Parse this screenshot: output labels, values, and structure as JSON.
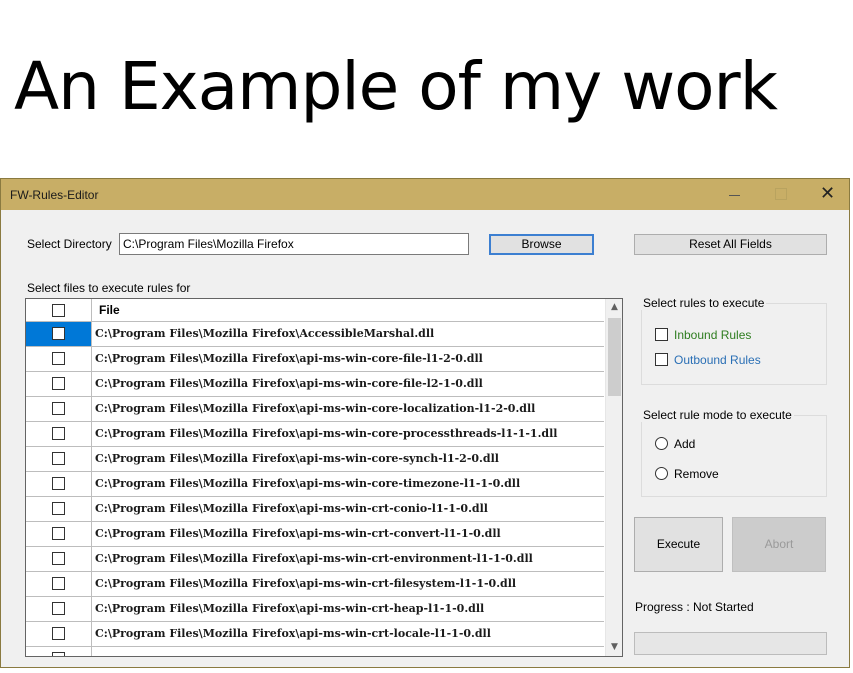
{
  "headline": "An Example of my work",
  "window": {
    "title": "FW-Rules-Editor",
    "controls": {
      "minimize": "minimize",
      "maximize": "maximize",
      "close": "✕"
    }
  },
  "directory": {
    "label": "Select Directory",
    "value": "C:\\Program Files\\Mozilla Firefox",
    "browse_label": "Browse"
  },
  "reset_label": "Reset All Fields",
  "files": {
    "label": "Select files to execute rules for",
    "column_header": "File",
    "rows": [
      {
        "path": "C:\\Program Files\\Mozilla Firefox\\AccessibleMarshal.dll",
        "selected": true
      },
      {
        "path": "C:\\Program Files\\Mozilla Firefox\\api-ms-win-core-file-l1-2-0.dll",
        "selected": false
      },
      {
        "path": "C:\\Program Files\\Mozilla Firefox\\api-ms-win-core-file-l2-1-0.dll",
        "selected": false
      },
      {
        "path": "C:\\Program Files\\Mozilla Firefox\\api-ms-win-core-localization-l1-2-0.dll",
        "selected": false
      },
      {
        "path": "C:\\Program Files\\Mozilla Firefox\\api-ms-win-core-processthreads-l1-1-1.dll",
        "selected": false
      },
      {
        "path": "C:\\Program Files\\Mozilla Firefox\\api-ms-win-core-synch-l1-2-0.dll",
        "selected": false
      },
      {
        "path": "C:\\Program Files\\Mozilla Firefox\\api-ms-win-core-timezone-l1-1-0.dll",
        "selected": false
      },
      {
        "path": "C:\\Program Files\\Mozilla Firefox\\api-ms-win-crt-conio-l1-1-0.dll",
        "selected": false
      },
      {
        "path": "C:\\Program Files\\Mozilla Firefox\\api-ms-win-crt-convert-l1-1-0.dll",
        "selected": false
      },
      {
        "path": "C:\\Program Files\\Mozilla Firefox\\api-ms-win-crt-environment-l1-1-0.dll",
        "selected": false
      },
      {
        "path": "C:\\Program Files\\Mozilla Firefox\\api-ms-win-crt-filesystem-l1-1-0.dll",
        "selected": false
      },
      {
        "path": "C:\\Program Files\\Mozilla Firefox\\api-ms-win-crt-heap-l1-1-0.dll",
        "selected": false
      },
      {
        "path": "C:\\Program Files\\Mozilla Firefox\\api-ms-win-crt-locale-l1-1-0.dll",
        "selected": false
      },
      {
        "path": "",
        "selected": false
      }
    ]
  },
  "rules_group": {
    "title": "Select rules to execute",
    "inbound_label": "Inbound Rules",
    "outbound_label": "Outbound Rules"
  },
  "mode_group": {
    "title": "Select rule mode to execute",
    "add_label": "Add",
    "remove_label": "Remove"
  },
  "execute_label": "Execute",
  "abort_label": "Abort",
  "progress": {
    "text": "Progress : Not Started",
    "value": 0
  },
  "colors": {
    "titlebar": "#c8ae66",
    "selection": "#0078d7",
    "inbound": "#2e7d1f",
    "outbound": "#2a6fb5"
  },
  "icons": {
    "scroll_up": "▲",
    "scroll_down": "▼"
  }
}
